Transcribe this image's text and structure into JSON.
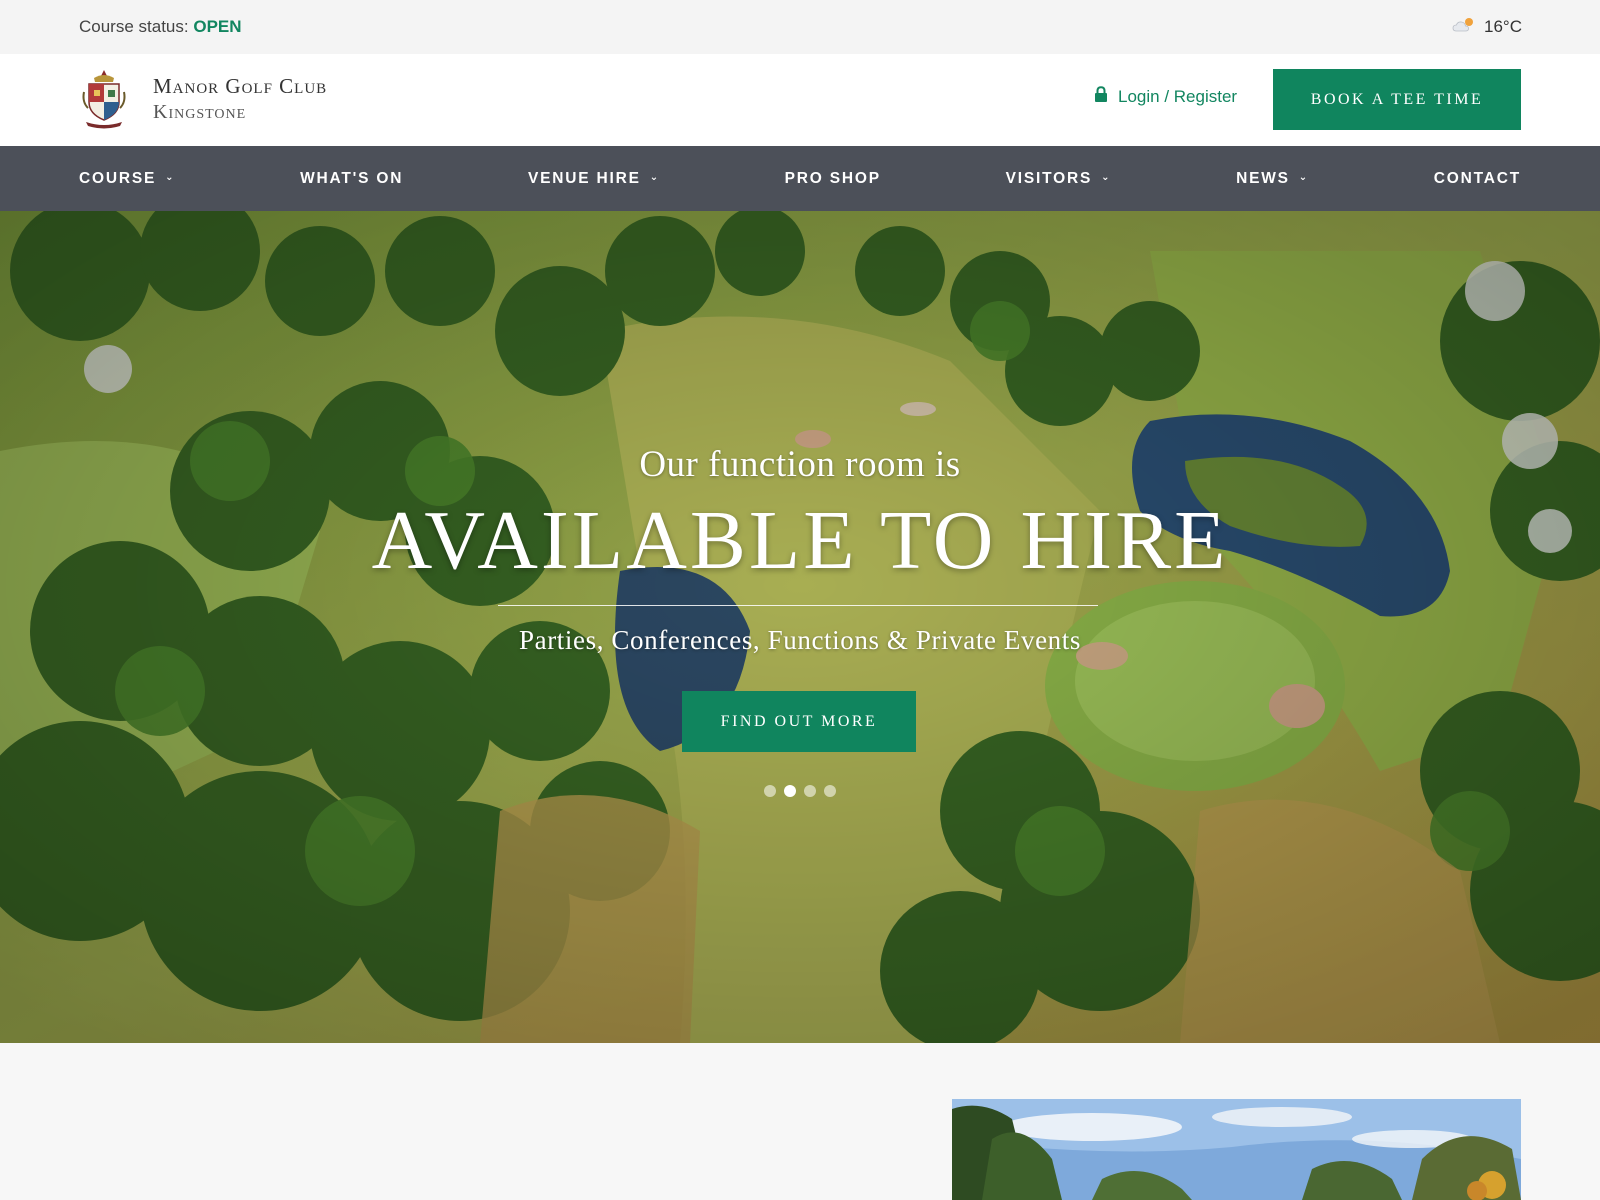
{
  "utility": {
    "status_label": "Course status:",
    "status_value": "OPEN",
    "weather_icon": "partly-cloudy-icon",
    "temperature": "16°C"
  },
  "header": {
    "logo_line1": "Manor Golf Club",
    "logo_line2": "Kingstone",
    "login_label": "Login / Register",
    "book_button": "BOOK A TEE TIME"
  },
  "nav": {
    "items": [
      {
        "label": "COURSE",
        "has_dropdown": true
      },
      {
        "label": "WHAT'S ON",
        "has_dropdown": false
      },
      {
        "label": "VENUE HIRE",
        "has_dropdown": true
      },
      {
        "label": "PRO SHOP",
        "has_dropdown": false
      },
      {
        "label": "VISITORS",
        "has_dropdown": true
      },
      {
        "label": "NEWS",
        "has_dropdown": true
      },
      {
        "label": "CONTACT",
        "has_dropdown": false
      }
    ]
  },
  "hero": {
    "kicker": "Our function room is",
    "title": "AVAILABLE TO HIRE",
    "subtitle": "Parties, Conferences, Functions & Private Events",
    "button": "FIND OUT MORE",
    "slide_count": 4,
    "active_slide": 1
  },
  "colors": {
    "brand_green": "#10855e",
    "nav_bg": "#4c5059",
    "status_green": "#128660"
  }
}
